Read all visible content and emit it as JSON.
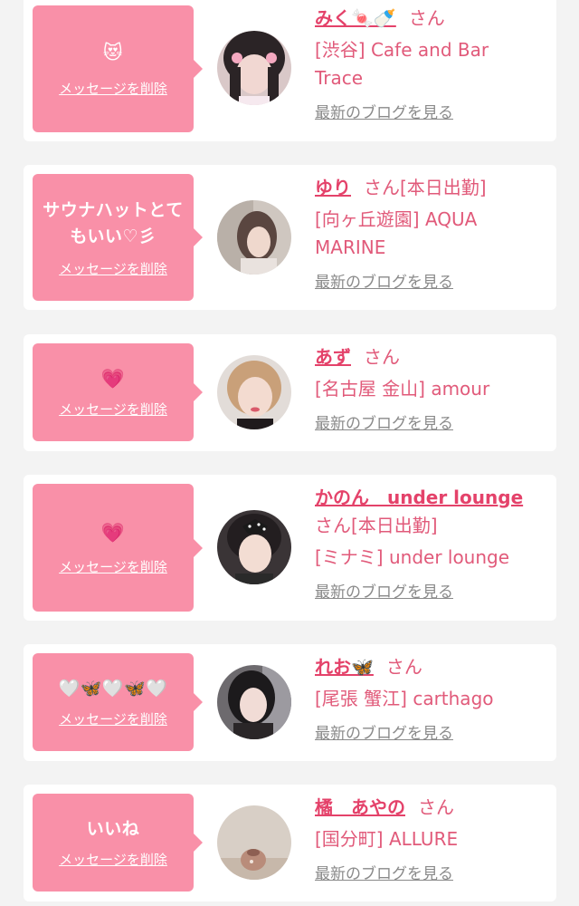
{
  "colors": {
    "bubble": "#f990a8",
    "accent": "#e4426a",
    "text_pink": "#e15a7a",
    "link_gray": "#8a8a8a",
    "background": "#f3f3f3"
  },
  "items": [
    {
      "message": "😻",
      "delete_label": "メッセージを削除",
      "name": "みく🍬🍼",
      "san": "さん",
      "status": "",
      "shop": "[渋谷] Cafe and Bar Trace",
      "blog_label": "最新のブログを見る",
      "avatar_icon": "avatar-photo"
    },
    {
      "message": "サウナハットとてもいい♡彡",
      "delete_label": "メッセージを削除",
      "name": "ゆり",
      "san": "さん",
      "status": "[本日出勤]",
      "shop": "[向ヶ丘遊園] AQUA MARINE",
      "blog_label": "最新のブログを見る",
      "avatar_icon": "avatar-photo"
    },
    {
      "message": "💗",
      "delete_label": "メッセージを削除",
      "name": "あず",
      "san": "さん",
      "status": "",
      "shop": "[名古屋 金山] amour",
      "blog_label": "最新のブログを見る",
      "avatar_icon": "avatar-photo"
    },
    {
      "message": "💗",
      "delete_label": "メッセージを削除",
      "name": "かのん　under lounge",
      "san": "さん",
      "status": "[本日出勤]",
      "shop": "[ミナミ] under lounge",
      "blog_label": "最新のブログを見る",
      "avatar_icon": "avatar-photo"
    },
    {
      "message": "🤍🦋🤍🦋🤍",
      "delete_label": "メッセージを削除",
      "name": "れお🦋",
      "san": "さん",
      "status": "",
      "shop": "[尾張 蟹江] carthago",
      "blog_label": "最新のブログを見る",
      "avatar_icon": "avatar-photo"
    },
    {
      "message": "いいね",
      "delete_label": "メッセージを削除",
      "name": "橘　あやの",
      "san": "さん",
      "status": "",
      "shop": "[国分町] ALLURE",
      "blog_label": "最新のブログを見る",
      "avatar_icon": "avatar-photo"
    }
  ]
}
